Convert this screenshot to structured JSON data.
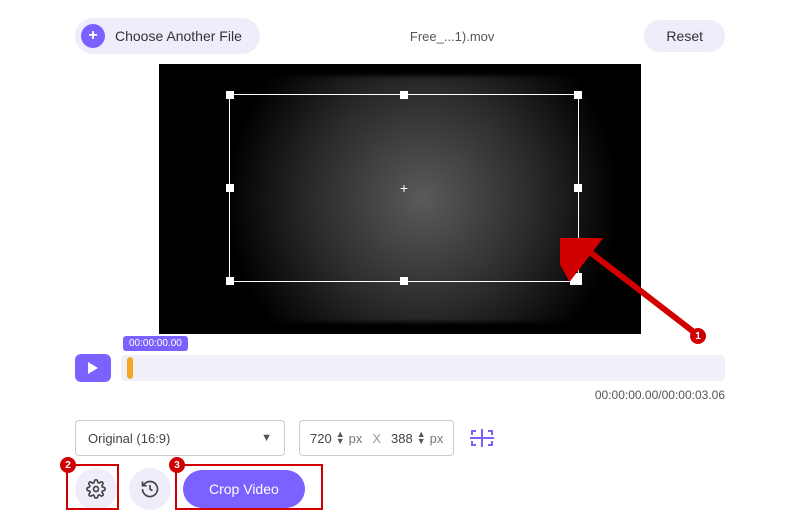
{
  "top": {
    "choose_label": "Choose Another File",
    "filename": "Free_...1).mov",
    "reset_label": "Reset"
  },
  "crop": {
    "center_marker": "+"
  },
  "timeline": {
    "badge_time": "00:00:00.00",
    "readout": "00:00:00.00/00:00:03.06"
  },
  "controls": {
    "aspect_label": "Original (16:9)",
    "width_value": "720",
    "height_value": "388",
    "px_label": "px",
    "x_label": "X"
  },
  "bottom": {
    "crop_button_label": "Crop Video"
  },
  "annotations": {
    "n1": "1",
    "n2": "2",
    "n3": "3"
  }
}
